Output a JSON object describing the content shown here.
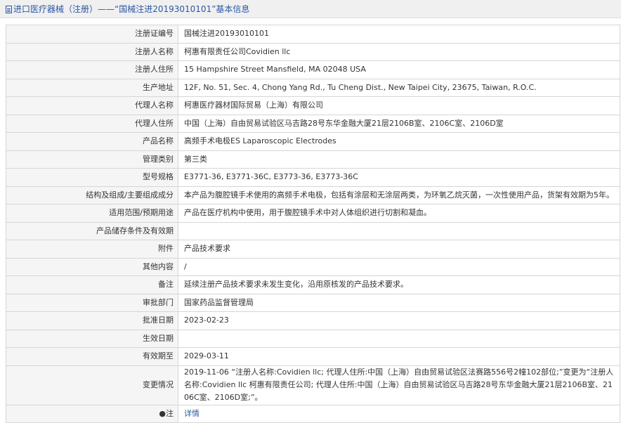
{
  "header": {
    "title": "进口医疗器械（注册）——“国械注进20193010101”基本信息"
  },
  "rows": [
    {
      "label": "注册证编号",
      "value": "国械注进20193010101"
    },
    {
      "label": "注册人名称",
      "value": "柯惠有限责任公司Covidien llc"
    },
    {
      "label": "注册人住所",
      "value": "15 Hampshire Street Mansfield, MA 02048 USA"
    },
    {
      "label": "生产地址",
      "value": "12F, No. 51, Sec. 4, Chong Yang Rd., Tu Cheng Dist., New Taipei City, 23675, Taiwan, R.O.C."
    },
    {
      "label": "代理人名称",
      "value": "柯惠医疗器材国际贸易（上海）有限公司"
    },
    {
      "label": "代理人住所",
      "value": "中国（上海）自由贸易试验区马吉路28号东华金融大厦21层2106B室、2106C室、2106D室"
    },
    {
      "label": "产品名称",
      "value": "高频手术电极ES Laparoscopic Electrodes"
    },
    {
      "label": "管理类别",
      "value": "第三类"
    },
    {
      "label": "型号规格",
      "value": "E3771-36, E3771-36C, E3773-36, E3773-36C"
    },
    {
      "label": "结构及组成/主要组成成分",
      "value": "本产品为腹腔镜手术使用的高频手术电极，包括有涂层和无涂层两类，为环氧乙烷灭菌，一次性使用产品，货架有效期为5年。"
    },
    {
      "label": "适用范围/预期用途",
      "value": "产品在医疗机构中使用，用于腹腔镜手术中对人体组织进行切割和凝血。"
    },
    {
      "label": "产品储存条件及有效期",
      "value": ""
    },
    {
      "label": "附件",
      "value": "产品技术要求"
    },
    {
      "label": "其他内容",
      "value": "/"
    },
    {
      "label": "备注",
      "value": "延续注册产品技术要求未发生变化，沿用原核发的产品技术要求。"
    },
    {
      "label": "审批部门",
      "value": "国家药品监督管理局"
    },
    {
      "label": "批准日期",
      "value": "2023-02-23"
    },
    {
      "label": "生效日期",
      "value": ""
    },
    {
      "label": "有效期至",
      "value": "2029-03-11"
    }
  ],
  "change": {
    "label": "变更情况",
    "value": "2019-11-06 “注册人名称:Covidien llc; 代理人住所:中国（上海）自由贸易试验区法赛路556号2幢102部位;”变更为“注册人名称:Covidien llc 柯惠有限责任公司; 代理人住所:中国（上海）自由贸易试验区马吉路28号东华金融大厦21层2106B室、2106C室、2106D室;”。"
  },
  "note": {
    "label": "●注",
    "link": "详情"
  }
}
